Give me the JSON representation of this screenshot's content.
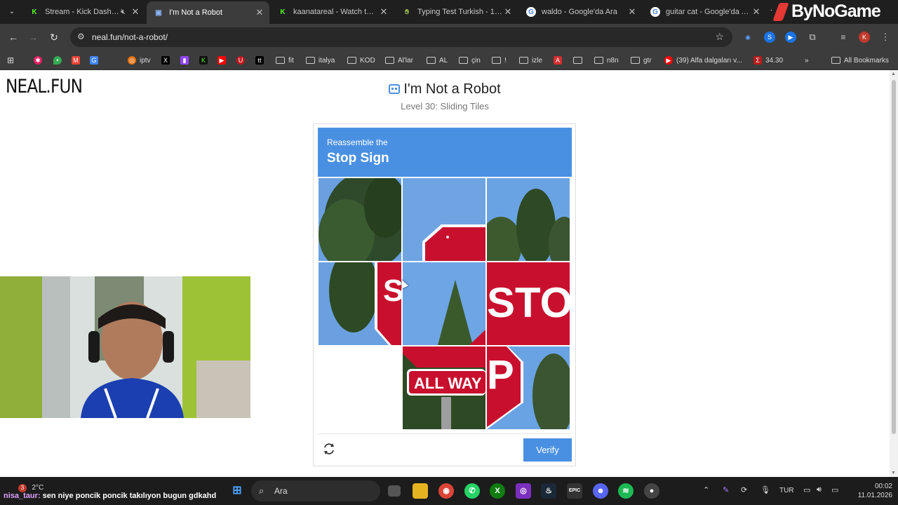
{
  "tabs": [
    {
      "title": "Stream - Kick Dashboa",
      "favicon": "kick-icon",
      "color": "#53fc18"
    },
    {
      "title": "I'm Not a Robot",
      "favicon": "robot-icon",
      "color": "#4a90e2"
    },
    {
      "title": "kaanatareal - Watch the V",
      "favicon": "kick-icon",
      "color": "#53fc18"
    },
    {
      "title": "Typing Test Turkish - 10Fa",
      "favicon": "tenfastfingers-icon",
      "color": "#6a8a2a"
    },
    {
      "title": "waldo - Google'da Ara",
      "favicon": "google-icon",
      "color": "#ffffff"
    },
    {
      "title": "guitar cat - Google'da Ara",
      "favicon": "google-icon",
      "color": "#ffffff"
    }
  ],
  "brand": "ByNoGame",
  "address": {
    "url": "neal.fun/not-a-robot/"
  },
  "profile_initial": "K",
  "bookmarks": [
    {
      "label": "iptv",
      "type": "site"
    },
    {
      "label": "",
      "type": "x"
    },
    {
      "label": "",
      "type": "twitch"
    },
    {
      "label": "",
      "type": "kick"
    },
    {
      "label": "",
      "type": "youtube"
    },
    {
      "label": "",
      "type": "u"
    },
    {
      "label": "",
      "type": "tt"
    },
    {
      "label": "fit",
      "type": "folder"
    },
    {
      "label": "italya",
      "type": "folder"
    },
    {
      "label": "KOD",
      "type": "folder"
    },
    {
      "label": "Al'lar",
      "type": "folder"
    },
    {
      "label": "AL",
      "type": "folder"
    },
    {
      "label": "çin",
      "type": "folder"
    },
    {
      "label": "!",
      "type": "folder"
    },
    {
      "label": "izle",
      "type": "folder"
    },
    {
      "label": "",
      "type": "pdf"
    },
    {
      "label": "",
      "type": "folder"
    },
    {
      "label": "n8n",
      "type": "folder"
    },
    {
      "label": "gtr",
      "type": "folder"
    },
    {
      "label": "(39) Alfa dalgaları v...",
      "type": "youtube"
    },
    {
      "label": "34.30",
      "type": "site"
    }
  ],
  "all_bookmarks": "All Bookmarks",
  "page": {
    "logo": "NEAL.FUN",
    "title": "I'm Not a Robot",
    "subtitle": "Level 30: Sliding Tiles",
    "captcha": {
      "instruction": "Reassemble the",
      "target": "Stop Sign",
      "verify": "Verify",
      "tiles": [
        {
          "row": 0,
          "col": 0,
          "content": "trees"
        },
        {
          "row": 0,
          "col": 1,
          "content": "sign-top"
        },
        {
          "row": 0,
          "col": 2,
          "content": "trees-sky"
        },
        {
          "row": 1,
          "col": 0,
          "content": "sign-left-S"
        },
        {
          "row": 1,
          "col": 1,
          "content": "sky-tree"
        },
        {
          "row": 1,
          "col": 2,
          "content": "sign-STO"
        },
        {
          "row": 2,
          "col": 0,
          "content": "empty"
        },
        {
          "row": 2,
          "col": 1,
          "content": "sign-ALLWAY"
        },
        {
          "row": 2,
          "col": 2,
          "content": "sign-P"
        }
      ]
    }
  },
  "taskbar": {
    "weather": "2°C",
    "weather_badge": "3",
    "chat_user": "nisa_taur:",
    "chat_message": "sen niye poncik poncik takılıyon bugun gdkahd",
    "search_placeholder": "Ara",
    "language": "TUR",
    "time": "00:02",
    "date": "11.01.2026"
  }
}
